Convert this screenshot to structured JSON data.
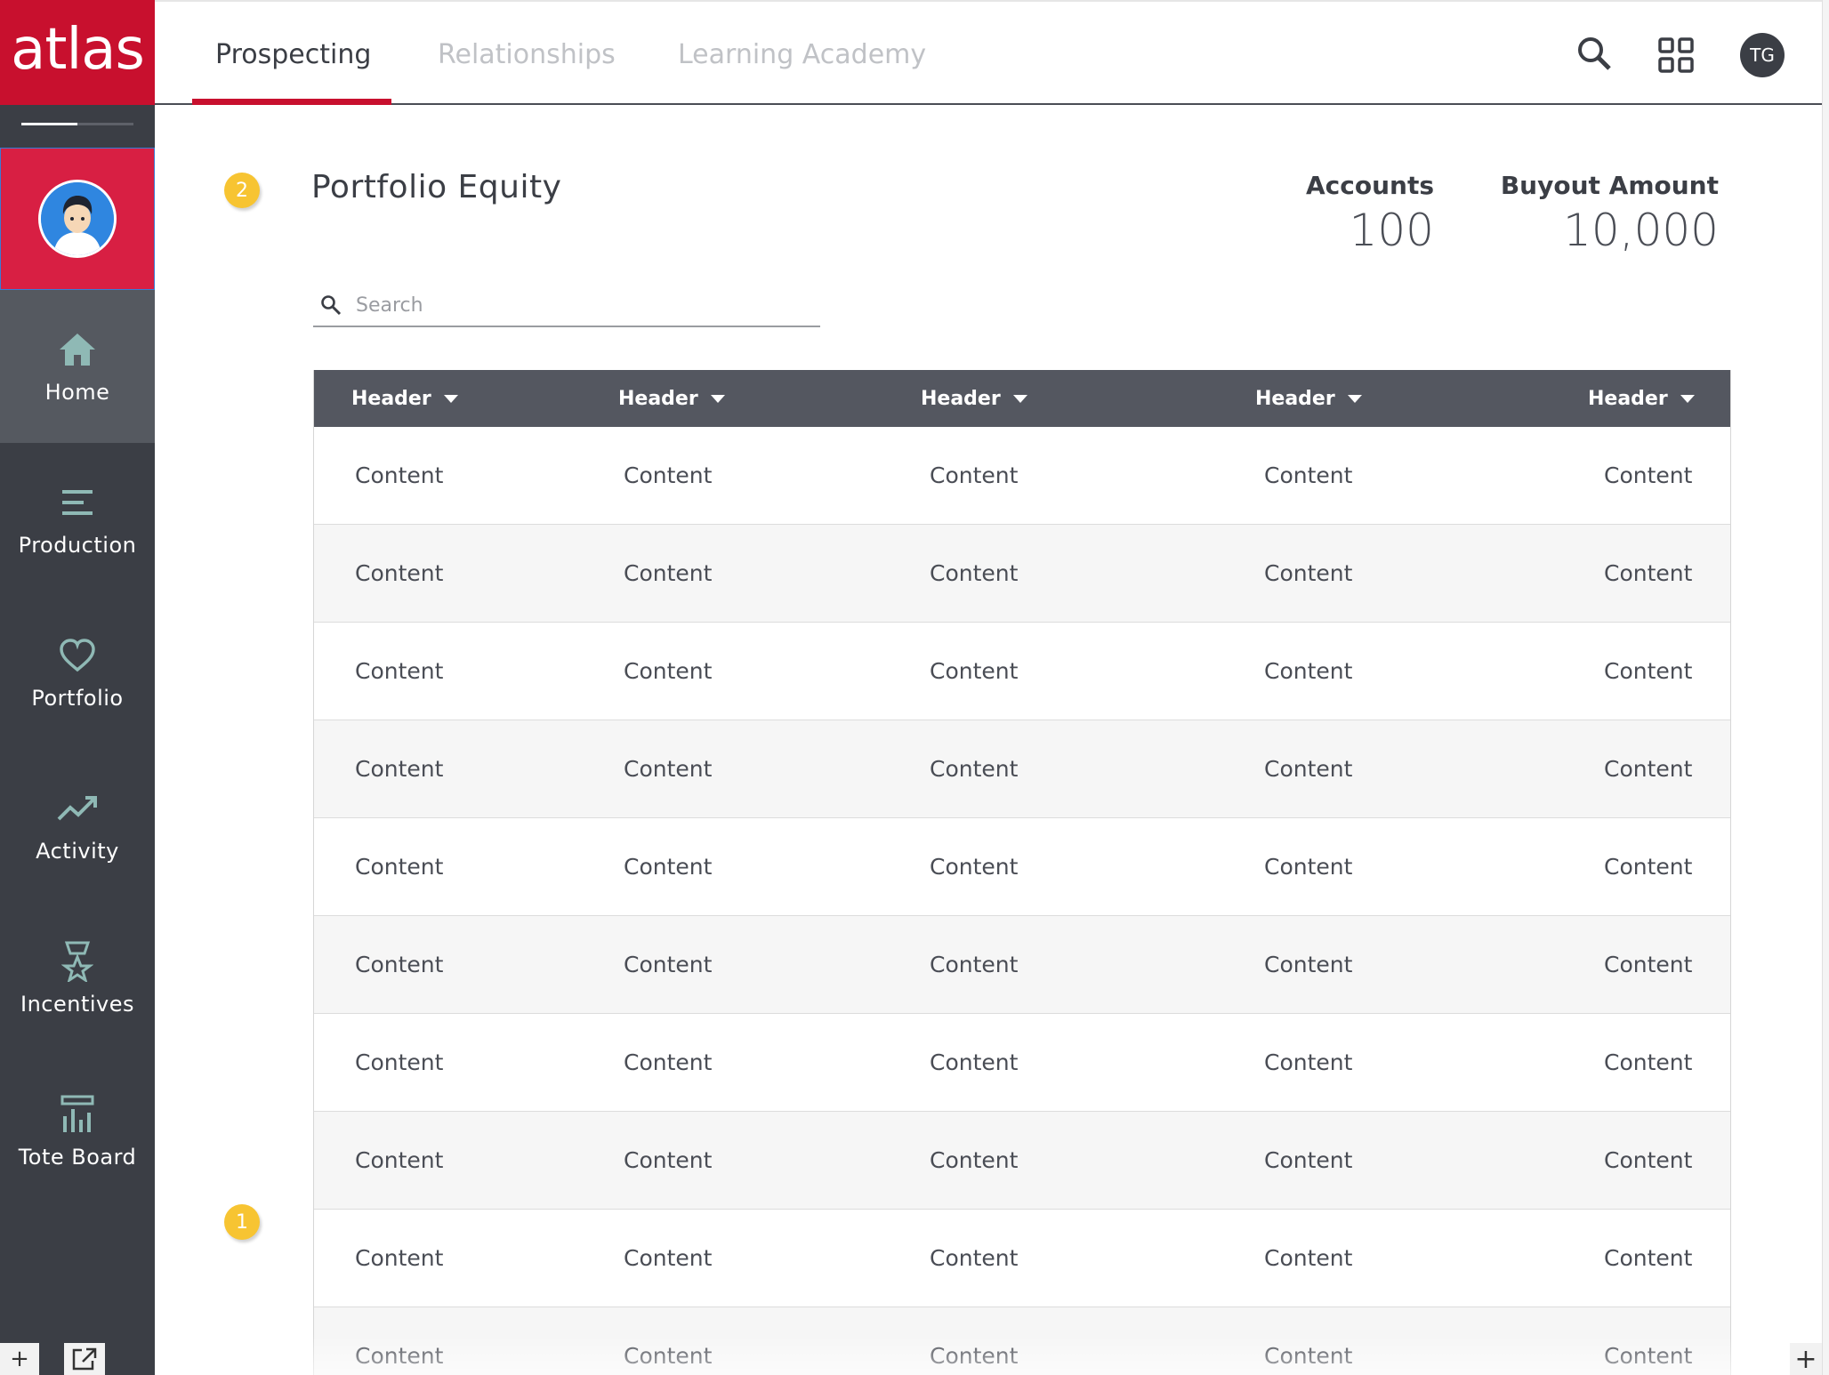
{
  "brand": {
    "logo_text": "atlas",
    "color": "#c8102e"
  },
  "sidebar": {
    "progress": 0.5,
    "items": [
      {
        "label": "Home",
        "icon": "home-icon",
        "active": true
      },
      {
        "label": "Production",
        "icon": "menu-lines-icon",
        "active": false
      },
      {
        "label": "Portfolio",
        "icon": "heart-icon",
        "active": false
      },
      {
        "label": "Activity",
        "icon": "trending-up-icon",
        "active": false
      },
      {
        "label": "Incentives",
        "icon": "award-star-icon",
        "active": false
      },
      {
        "label": "Tote Board",
        "icon": "tote-board-icon",
        "active": false
      }
    ],
    "bottom": {
      "add": "+",
      "popout_icon": "external-link-icon"
    }
  },
  "topbar": {
    "tabs": [
      {
        "label": "Prospecting",
        "active": true
      },
      {
        "label": "Relationships",
        "active": false
      },
      {
        "label": "Learning Academy",
        "active": false
      }
    ],
    "icons": [
      "search-icon",
      "apps-grid-icon"
    ],
    "user_initials": "TG"
  },
  "main": {
    "step_badges": [
      "2",
      "1"
    ],
    "title": "Portfolio Equity",
    "stats": [
      {
        "label": "Accounts",
        "value": "100"
      },
      {
        "label": "Buyout Amount",
        "value": "10,000"
      }
    ],
    "search": {
      "placeholder": "Search"
    },
    "table": {
      "headers": [
        "Header",
        "Header",
        "Header",
        "Header",
        "Header"
      ],
      "rows": [
        [
          "Content",
          "Content",
          "Content",
          "Content",
          "Content"
        ],
        [
          "Content",
          "Content",
          "Content",
          "Content",
          "Content"
        ],
        [
          "Content",
          "Content",
          "Content",
          "Content",
          "Content"
        ],
        [
          "Content",
          "Content",
          "Content",
          "Content",
          "Content"
        ],
        [
          "Content",
          "Content",
          "Content",
          "Content",
          "Content"
        ],
        [
          "Content",
          "Content",
          "Content",
          "Content",
          "Content"
        ],
        [
          "Content",
          "Content",
          "Content",
          "Content",
          "Content"
        ],
        [
          "Content",
          "Content",
          "Content",
          "Content",
          "Content"
        ],
        [
          "Content",
          "Content",
          "Content",
          "Content",
          "Content"
        ],
        [
          "Content",
          "Content",
          "Content",
          "Content",
          "Content"
        ]
      ]
    },
    "add_button": "+"
  }
}
